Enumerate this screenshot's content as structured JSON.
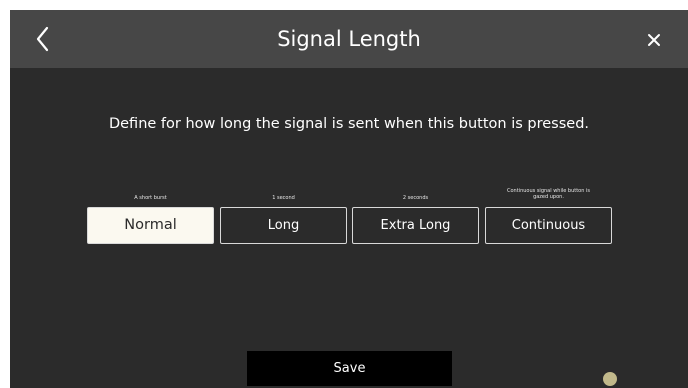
{
  "header": {
    "title": "Signal Length",
    "back_icon": "chevron-left-icon",
    "close_icon": "close-icon"
  },
  "prompt": "Define for how long the signal is sent when this button is pressed.",
  "options": [
    {
      "label": "Normal",
      "caption": "A short burst",
      "selected": true
    },
    {
      "label": "Long",
      "caption": "1 second",
      "selected": false
    },
    {
      "label": "Extra Long",
      "caption": "2 seconds",
      "selected": false
    },
    {
      "label": "Continuous",
      "caption": "Continuous signal while button is gazed upon.",
      "selected": false
    }
  ],
  "save_label": "Save",
  "colors": {
    "background": "#2b2b2b",
    "titlebar": "#474747",
    "selected_option": "#fbf9f0",
    "save_button": "#000000",
    "gaze_indicator": "#c2b98b"
  }
}
